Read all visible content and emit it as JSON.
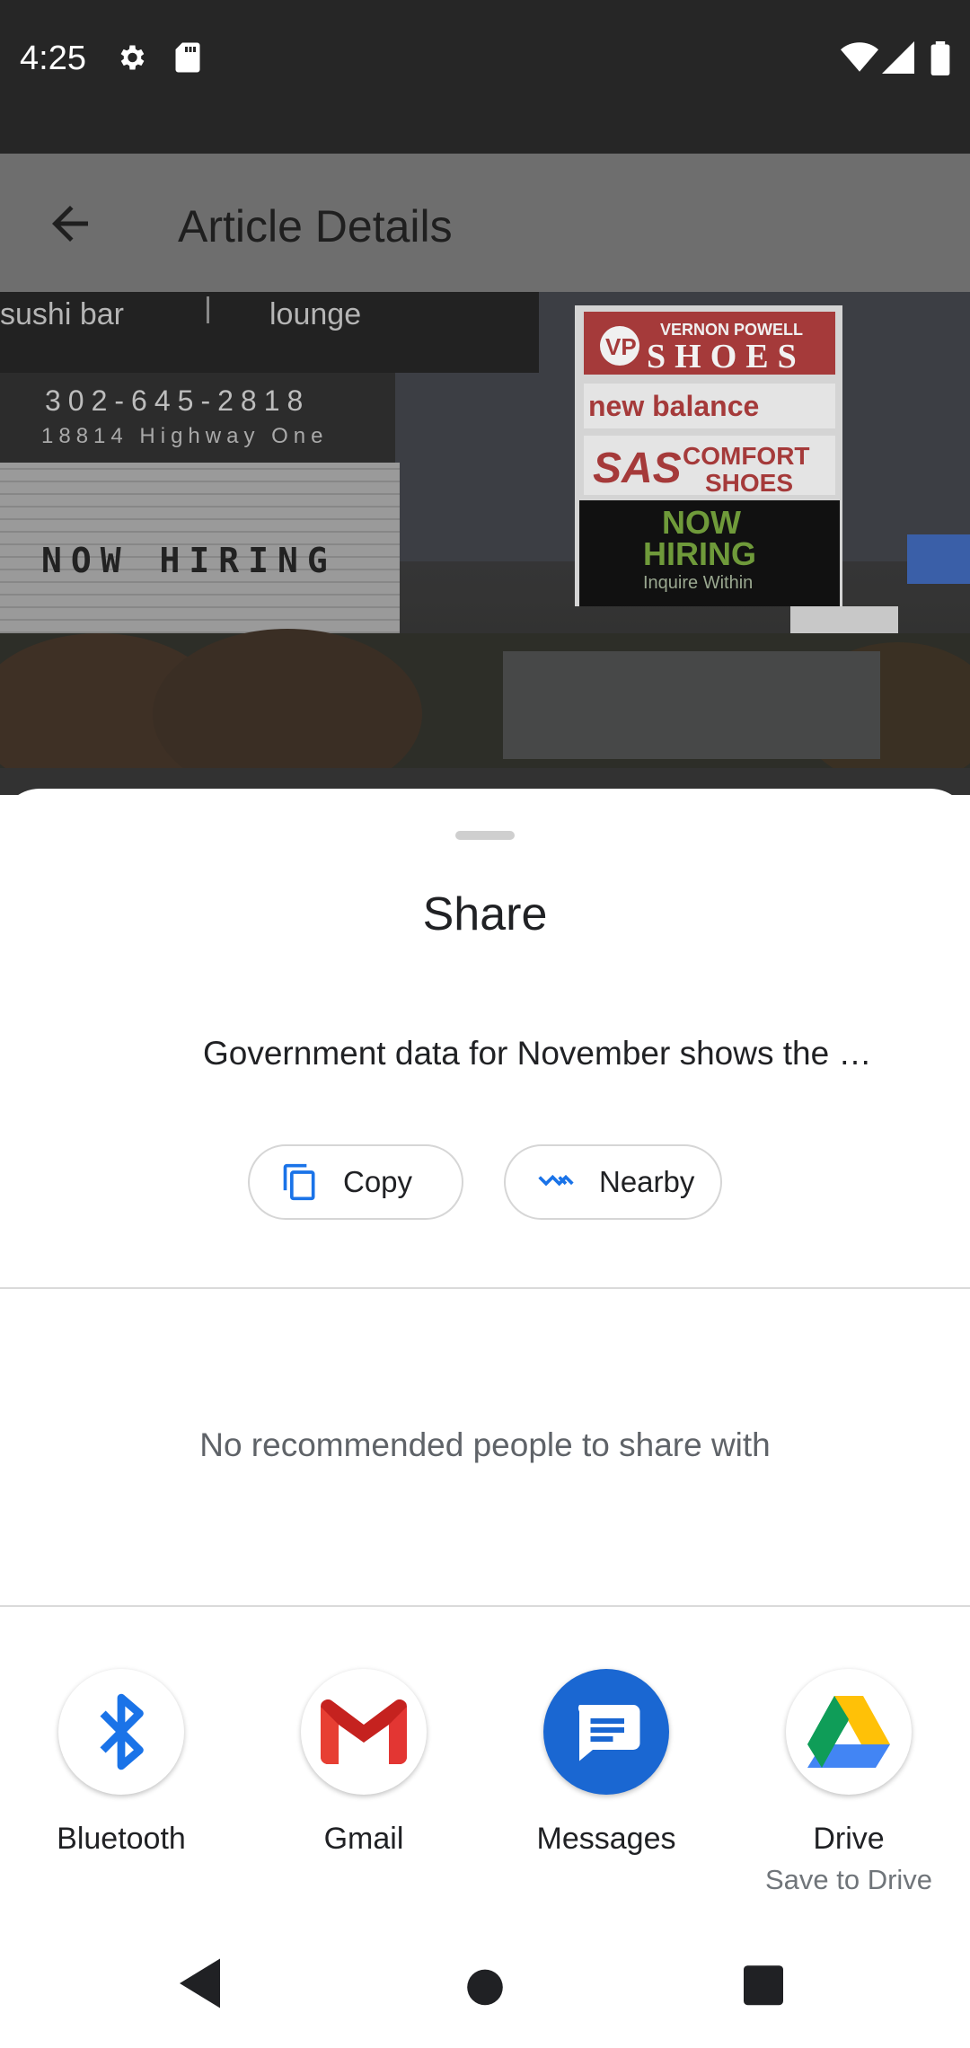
{
  "status_bar": {
    "time": "4:25",
    "icons": [
      "settings-icon",
      "sd-card-icon",
      "wifi-icon",
      "signal-icon",
      "battery-icon"
    ]
  },
  "app_bar": {
    "title": "Article Details",
    "back_icon": "arrow-back-icon"
  },
  "hero": {
    "sign_left_top": "sushi bar",
    "sign_left_top2": "lounge",
    "phone": "302-645-2818",
    "address": "18814 Highway One",
    "now_hiring_left": "NOW HIRING",
    "vernon": "VERNON POWELL",
    "shoes": "SHOES",
    "new_balance": "new balance",
    "sas": "SAS",
    "comfort": "COMFORT",
    "comfort_shoes": "SHOES",
    "now": "NOW",
    "hiring": "HIRING",
    "inquire": "Inquire Within"
  },
  "share_sheet": {
    "title": "Share",
    "preview_text": "Government data for November shows the …",
    "chips": [
      {
        "label": "Copy",
        "icon": "copy-icon"
      },
      {
        "label": "Nearby",
        "icon": "nearby-icon"
      }
    ],
    "no_people_text": "No recommended people to share with",
    "targets": [
      {
        "label": "Bluetooth",
        "sublabel": "",
        "icon": "bluetooth-icon"
      },
      {
        "label": "Gmail",
        "sublabel": "",
        "icon": "gmail-icon"
      },
      {
        "label": "Messages",
        "sublabel": "",
        "icon": "messages-icon"
      },
      {
        "label": "Drive",
        "sublabel": "Save to Drive",
        "icon": "drive-icon"
      }
    ]
  },
  "nav_bar": {
    "buttons": [
      "back-triangle-icon",
      "home-circle-icon",
      "recents-square-icon"
    ]
  },
  "colors": {
    "status_bar_bg": "#262626",
    "scrim_app_bar": "#6e6e6e",
    "accent_blue": "#1a73e8",
    "messages_blue": "#1a67d2"
  }
}
